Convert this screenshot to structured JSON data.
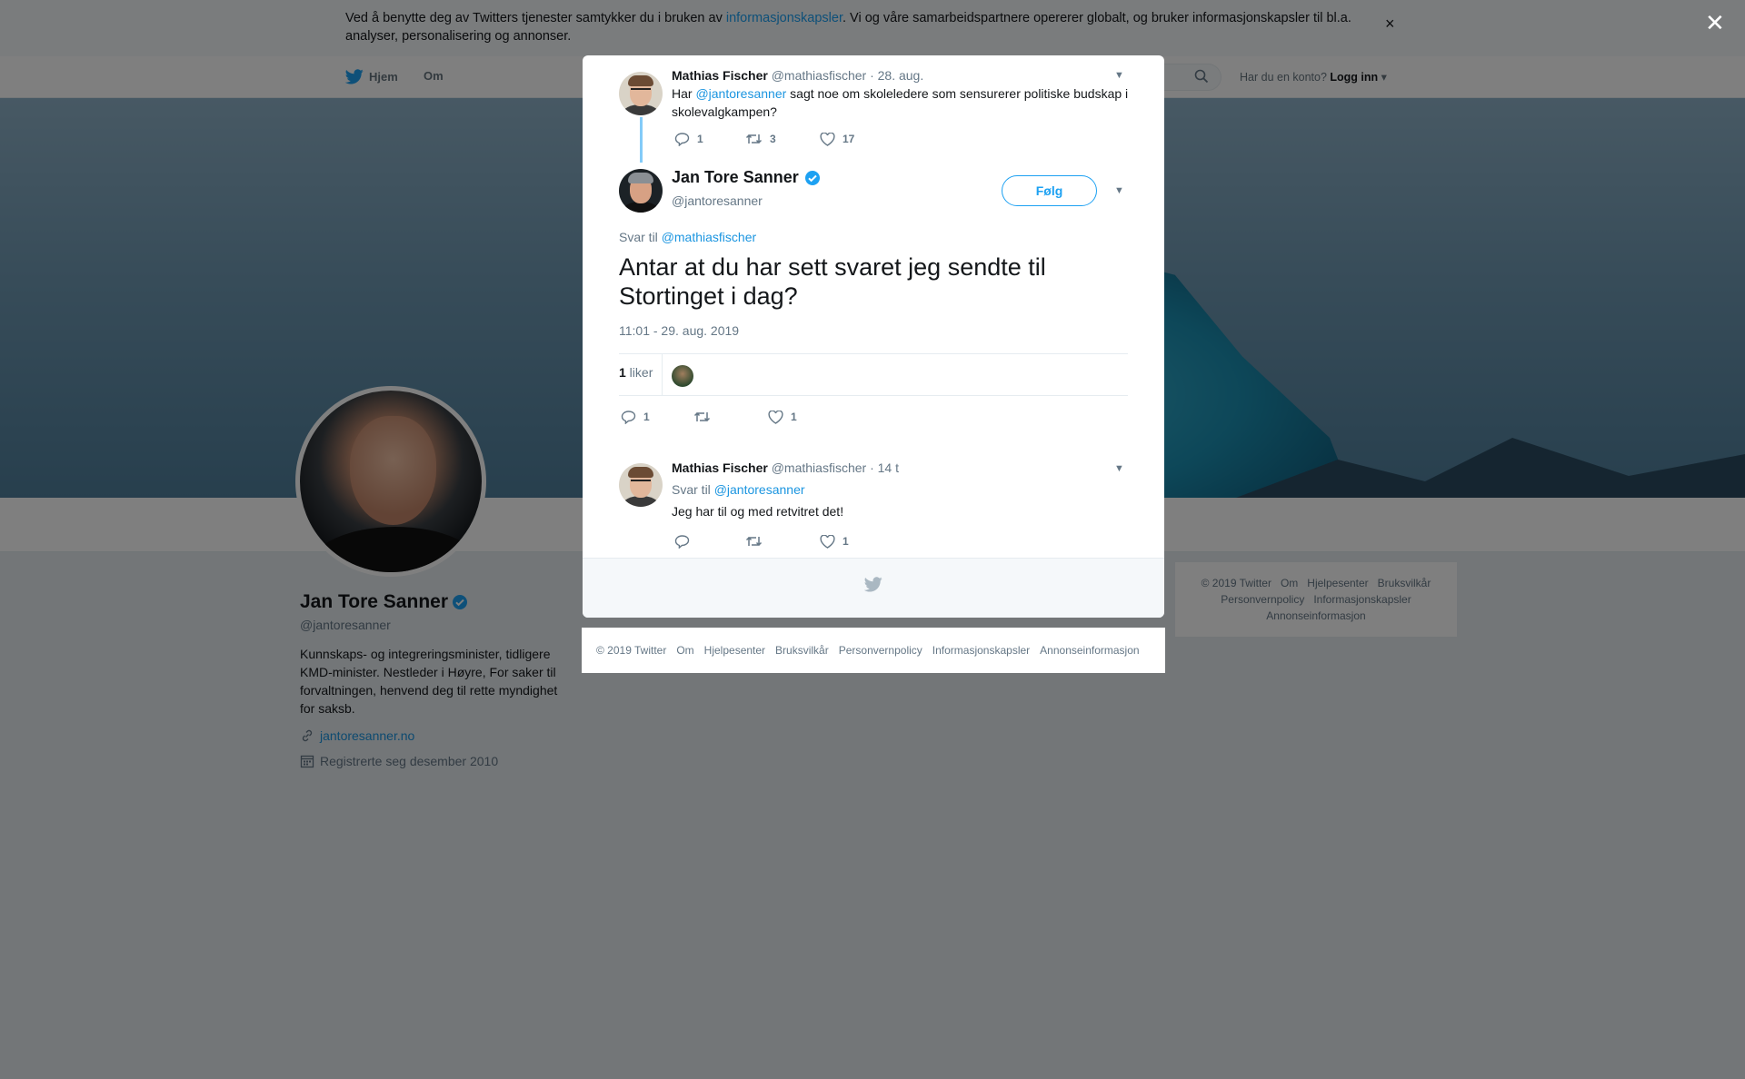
{
  "cookie": {
    "text_before": "Ved å benytte deg av Twitters tjenester samtykker du i bruken av ",
    "link": "informasjonskapsler",
    "text_after": ". Vi og våre samarbeidspartnere opererer globalt, og bruker informasjonskapsler til bl.a. analyser, personalisering og annonser.",
    "close": "×"
  },
  "nav": {
    "home": "Hjem",
    "about": "Om",
    "login_prompt": "Har du en konto?",
    "login": "Logg inn"
  },
  "profile": {
    "name": "Jan Tore Sanner",
    "handle": "@jantoresanner",
    "bio": "Kunnskaps- og integreringsminister, tidligere KMD-minister. Nestleder i Høyre, For saker til forvaltningen, henvend deg til rette myndighet for saksb.",
    "website": "jantoresanner.no",
    "joined": "Registrerte seg desember 2010"
  },
  "side_footer": [
    "© 2019 Twitter",
    "Om",
    "Hjelpesenter",
    "Bruksvilkår",
    "Personvernpolicy",
    "Informasjonskapsler",
    "Annonseinformasjon"
  ],
  "modal": {
    "parent": {
      "name": "Mathias Fischer",
      "handle": "@mathiasfischer",
      "date": "· 28. aug.",
      "text_before": "Har ",
      "mention": "@jantoresanner",
      "text_after": " sagt noe om skoleledere som sensurerer politiske budskap i skolevalgkampen?",
      "replies": "1",
      "retweets": "3",
      "likes": "17"
    },
    "main": {
      "name": "Jan Tore Sanner",
      "handle": "@jantoresanner",
      "follow": "Følg",
      "reply_to_label": "Svar til ",
      "reply_to": "@mathiasfischer",
      "text": "Antar at du har sett svaret jeg sendte til Stortinget i dag?",
      "time": "11:01 - 29. aug. 2019",
      "like_count": "1",
      "like_label": " liker",
      "replies": "1",
      "likes": "1"
    },
    "reply": {
      "name": "Mathias Fischer",
      "handle": "@mathiasfischer",
      "date": "· 14 t",
      "reply_to_label": "Svar til ",
      "reply_to": "@jantoresanner",
      "text": "Jeg har til og med retvitret det!",
      "likes": "1"
    }
  },
  "page_footer": [
    "© 2019 Twitter",
    "Om",
    "Hjelpesenter",
    "Bruksvilkår",
    "Personvernpolicy",
    "Informasjonskapsler",
    "Annonseinformasjon"
  ],
  "colors": {
    "accent": "#1da1f2",
    "link": "#1b95e0",
    "muted": "#657786",
    "overlay": "rgba(0,0,0,0.5)"
  },
  "icons": [
    "twitter-bird-icon",
    "search-icon",
    "caret-down-icon",
    "verified-icon",
    "link-icon",
    "calendar-icon",
    "reply-icon",
    "retweet-icon",
    "heart-icon",
    "chevron-down-icon",
    "close-icon"
  ]
}
